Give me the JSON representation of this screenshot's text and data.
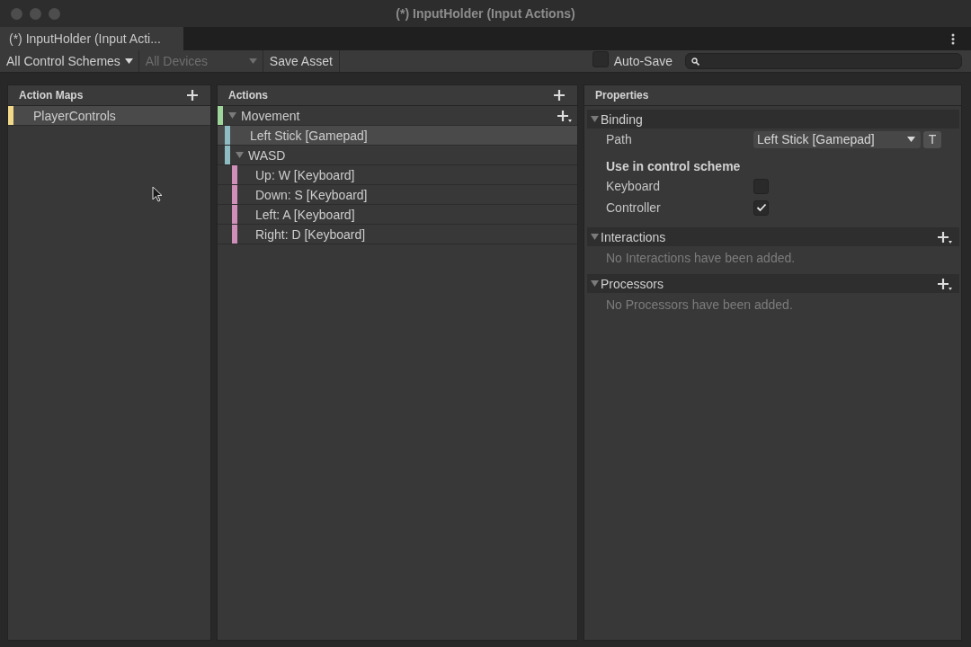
{
  "window": {
    "title": "(*) InputHolder (Input Actions)"
  },
  "tabs": [
    {
      "label": "(*) InputHolder (Input Acti...",
      "selected": true
    }
  ],
  "toolbar": {
    "control_scheme": "All Control Schemes",
    "devices": {
      "label": "All Devices",
      "disabled": true
    },
    "save_button": "Save Asset",
    "auto_save": {
      "label": "Auto-Save",
      "checked": false
    }
  },
  "action_maps": {
    "title": "Action Maps",
    "items": [
      {
        "label": "PlayerControls",
        "color": "#f2d98a",
        "selected": true
      }
    ]
  },
  "actions": {
    "title": "Actions",
    "items": [
      {
        "kind": "action",
        "label": "Movement",
        "color": "#9fd49a",
        "expanded": true,
        "selected": false,
        "children": [
          {
            "kind": "binding",
            "label": "Left Stick [Gamepad]",
            "color": "#8dbcc2",
            "selected": true
          },
          {
            "kind": "composite",
            "label": "WASD",
            "color": "#8dbcc2",
            "expanded": true,
            "selected": false,
            "children": [
              {
                "kind": "part",
                "label": "Up: W [Keyboard]",
                "color": "#cf8fb8",
                "selected": false
              },
              {
                "kind": "part",
                "label": "Down: S [Keyboard]",
                "color": "#cf8fb8",
                "selected": false
              },
              {
                "kind": "part",
                "label": "Left: A [Keyboard]",
                "color": "#cf8fb8",
                "selected": false
              },
              {
                "kind": "part",
                "label": "Right: D [Keyboard]",
                "color": "#cf8fb8",
                "selected": false
              }
            ]
          }
        ]
      }
    ]
  },
  "properties": {
    "title": "Properties",
    "sections": [
      {
        "kind": "binding",
        "title": "Binding",
        "expanded": true,
        "path_label": "Path",
        "path_value": "Left Stick [Gamepad]",
        "t_button": "T",
        "scheme_heading": "Use in control scheme",
        "schemes": [
          {
            "label": "Keyboard",
            "checked": false
          },
          {
            "label": "Controller",
            "checked": true
          }
        ]
      },
      {
        "kind": "list",
        "title": "Interactions",
        "expanded": true,
        "empty_message": "No Interactions have been added."
      },
      {
        "kind": "list",
        "title": "Processors",
        "expanded": true,
        "empty_message": "No Processors have been added."
      }
    ]
  }
}
